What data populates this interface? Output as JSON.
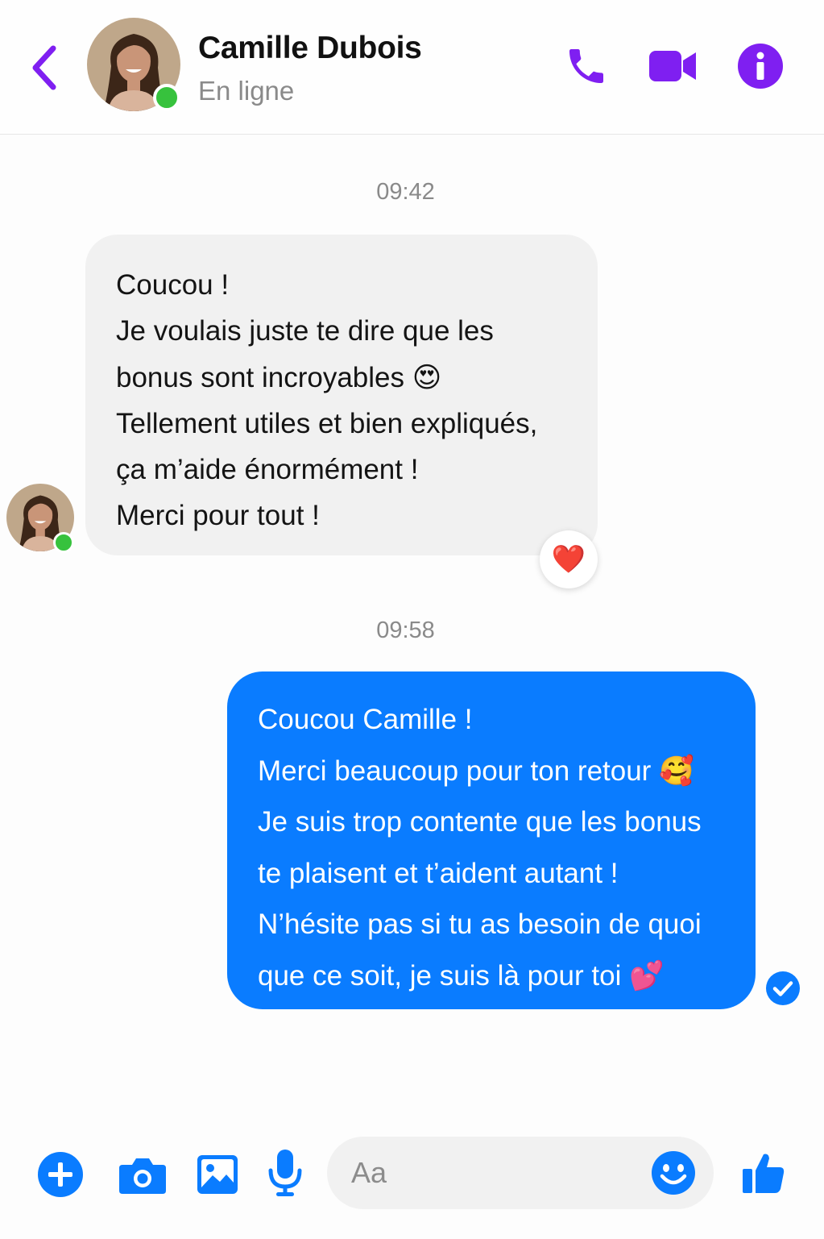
{
  "colors": {
    "accent_purple": "#7f1ff1",
    "sent_bubble": "#0a7cff",
    "received_bubble": "#f1f1f1",
    "online": "#37c23d"
  },
  "header": {
    "contact_name": "Camille Dubois",
    "status": "En ligne",
    "icons": [
      "back-chevron-icon",
      "phone-icon",
      "video-camera-icon",
      "info-icon"
    ]
  },
  "conversation": {
    "messages": [
      {
        "timestamp": "09:42",
        "sender": "contact",
        "lines": [
          "Coucou !",
          "Je voulais juste te dire que les",
          "bonus sont incroyables 😍",
          "Tellement utiles et bien expliqués,",
          "ça m’aide énormément !",
          "Merci pour tout !"
        ],
        "reaction": "❤️"
      },
      {
        "timestamp": "09:58",
        "sender": "me",
        "lines": [
          "Coucou Camille !",
          "Merci beaucoup pour ton retour 🥰",
          "Je suis trop contente que les bonus",
          "te plaisent et t’aident autant !",
          "N’hésite pas si tu as besoin de quoi",
          "que ce soit, je suis là pour toi 💕"
        ],
        "status_icon": "seen-check-icon"
      }
    ]
  },
  "composer": {
    "placeholder": "Aa",
    "icons": [
      "plus-icon",
      "camera-icon",
      "image-icon",
      "microphone-icon",
      "smiley-icon",
      "thumbs-up-icon"
    ]
  }
}
